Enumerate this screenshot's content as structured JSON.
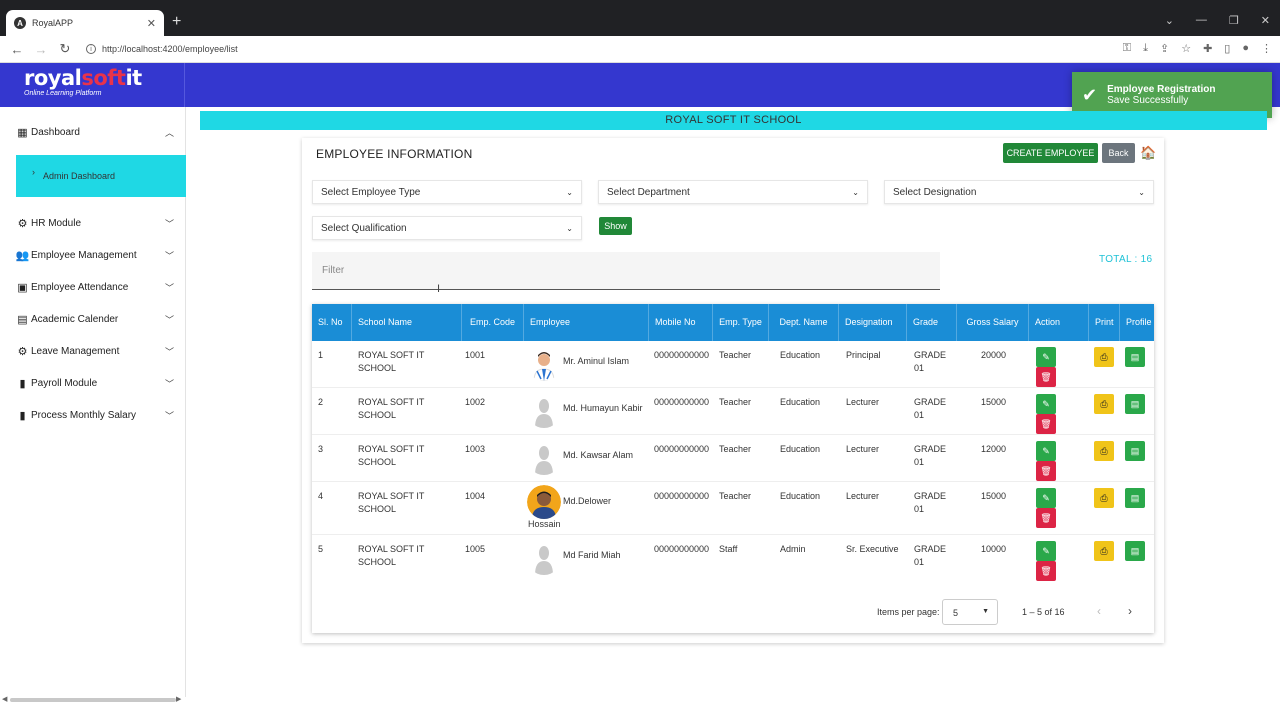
{
  "browser": {
    "tab_title": "RoyalAPP",
    "url": "http://localhost:4200/employee/list"
  },
  "brand": {
    "logo_part1": "royal",
    "logo_part2": "soft",
    "logo_part3": "it",
    "tagline": "Online Learning Platform"
  },
  "toast": {
    "title": "Employee Registration",
    "message": "Save Successfully"
  },
  "sidebar": {
    "items": [
      {
        "label": "Dashboard",
        "icon": "dashboard-icon"
      },
      {
        "label": "HR Module",
        "icon": "hr-icon"
      },
      {
        "label": "Employee Management",
        "icon": "users-icon"
      },
      {
        "label": "Employee Attendance",
        "icon": "calendar-check-icon"
      },
      {
        "label": "Academic Calender",
        "icon": "calendar-icon"
      },
      {
        "label": "Leave Management",
        "icon": "gear-icon"
      },
      {
        "label": "Payroll Module",
        "icon": "document-icon"
      },
      {
        "label": "Process Monthly Salary",
        "icon": "document-icon"
      }
    ],
    "sub_item": "Admin Dashboard"
  },
  "school_bar": "ROYAL SOFT IT SCHOOL",
  "card": {
    "title": "EMPLOYEE INFORMATION",
    "create_label": "CREATE EMPLOYEE",
    "back_label": "Back",
    "show_label": "Show"
  },
  "filters": {
    "employee_type": "Select Employee Type",
    "department": "Select Department",
    "designation": "Select Designation",
    "qualification": "Select Qualification"
  },
  "search": {
    "placeholder": "Filter"
  },
  "total": "TOTAL : 16",
  "table": {
    "headers": {
      "sl": "Sl. No",
      "school": "School Name",
      "code": "Emp. Code",
      "employee": "Employee",
      "mobile": "Mobile No",
      "type": "Emp. Type",
      "dept": "Dept. Name",
      "designation": "Designation",
      "grade": "Grade",
      "salary": "Gross Salary",
      "action": "Action",
      "print": "Print",
      "profile": "Profile"
    },
    "rows": [
      {
        "sl": "1",
        "school": "ROYAL SOFT IT SCHOOL",
        "code": "1001",
        "name": "Mr. Aminul Islam",
        "mobile": "00000000000",
        "type": "Teacher",
        "dept": "Education",
        "designation": "Principal",
        "grade": "GRADE 01",
        "salary": "20000"
      },
      {
        "sl": "2",
        "school": "ROYAL SOFT IT SCHOOL",
        "code": "1002",
        "name": "Md. Humayun Kabir",
        "mobile": "00000000000",
        "type": "Teacher",
        "dept": "Education",
        "designation": "Lecturer",
        "grade": "GRADE 01",
        "salary": "15000"
      },
      {
        "sl": "3",
        "school": "ROYAL SOFT IT SCHOOL",
        "code": "1003",
        "name": "Md. Kawsar Alam",
        "mobile": "00000000000",
        "type": "Teacher",
        "dept": "Education",
        "designation": "Lecturer",
        "grade": "GRADE 01",
        "salary": "12000"
      },
      {
        "sl": "4",
        "school": "ROYAL SOFT IT SCHOOL",
        "code": "1004",
        "name": "Md.Delower",
        "name2": "Hossain",
        "mobile": "00000000000",
        "type": "Teacher",
        "dept": "Education",
        "designation": "Lecturer",
        "grade": "GRADE 01",
        "salary": "15000"
      },
      {
        "sl": "5",
        "school": "ROYAL SOFT IT SCHOOL",
        "code": "1005",
        "name": "Md Farid Miah",
        "mobile": "00000000000",
        "type": "Staff",
        "dept": "Admin",
        "designation": "Sr. Executive",
        "grade": "GRADE 01",
        "salary": "10000"
      }
    ]
  },
  "pager": {
    "label": "Items per page:",
    "page_size": "5",
    "range": "1 – 5 of 16"
  },
  "colors": {
    "header_blue": "#3437cf",
    "accent_cyan": "#1fd8e4",
    "table_header": "#1a8dd6",
    "success": "#218838",
    "danger": "#dc2445",
    "warning": "#f0c419"
  }
}
